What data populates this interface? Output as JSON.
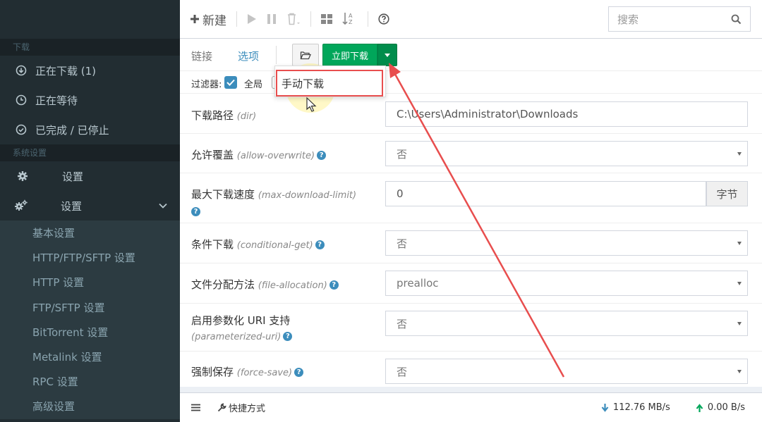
{
  "sidebar": {
    "sections": {
      "download_header": "下载",
      "system_header": "系统设置"
    },
    "downloads": [
      {
        "label": "正在下载 (1)",
        "icon": "arrow-circle-down-icon"
      },
      {
        "label": "正在等待",
        "icon": "clock-icon"
      },
      {
        "label": "已完成 / 已停止",
        "icon": "check-circle-icon"
      }
    ],
    "settings_item": "设置",
    "settings_group": "设置",
    "sub_items": [
      "基本设置",
      "HTTP/FTP/SFTP 设置",
      "HTTP 设置",
      "FTP/SFTP 设置",
      "BitTorrent 设置",
      "Metalink 设置",
      "RPC 设置",
      "高级设置"
    ]
  },
  "toolbar": {
    "new_label": "新建",
    "search_placeholder": "搜索"
  },
  "tabs": {
    "links": "链接",
    "options": "选项"
  },
  "actions": {
    "download_now": "立即下载",
    "dropdown_item": "手动下载"
  },
  "filter": {
    "label": "过滤器:",
    "global_label": "全局"
  },
  "options": [
    {
      "label": "下载路径",
      "key": "(dir)",
      "value": "C:\\Users\\Administrator\\Downloads",
      "type": "text",
      "help": false
    },
    {
      "label": "允许覆盖",
      "key": "(allow-overwrite)",
      "value": "否",
      "type": "select",
      "help": true
    },
    {
      "label": "最大下载速度",
      "key": "(max-download-limit)",
      "value": "0",
      "type": "unit",
      "unit": "字节",
      "help": true
    },
    {
      "label": "条件下载",
      "key": "(conditional-get)",
      "value": "否",
      "type": "select",
      "help": true
    },
    {
      "label": "文件分配方法",
      "key": "(file-allocation)",
      "value": "prealloc",
      "type": "select",
      "help": true
    },
    {
      "label": "启用参数化 URI 支持",
      "key": "(parameterized-uri)",
      "value": "否",
      "type": "select",
      "help": true
    },
    {
      "label": "强制保存",
      "key": "(force-save)",
      "value": "否",
      "type": "select",
      "help": true
    }
  ],
  "footer": {
    "shortcuts": "快捷方式",
    "download_speed": "112.76 MB/s",
    "upload_speed": "0.00 B/s"
  },
  "colors": {
    "sidebar_bg": "#222d32",
    "accent": "#3c8dbc",
    "success": "#00a65a",
    "annotation": "#e84e4e"
  }
}
